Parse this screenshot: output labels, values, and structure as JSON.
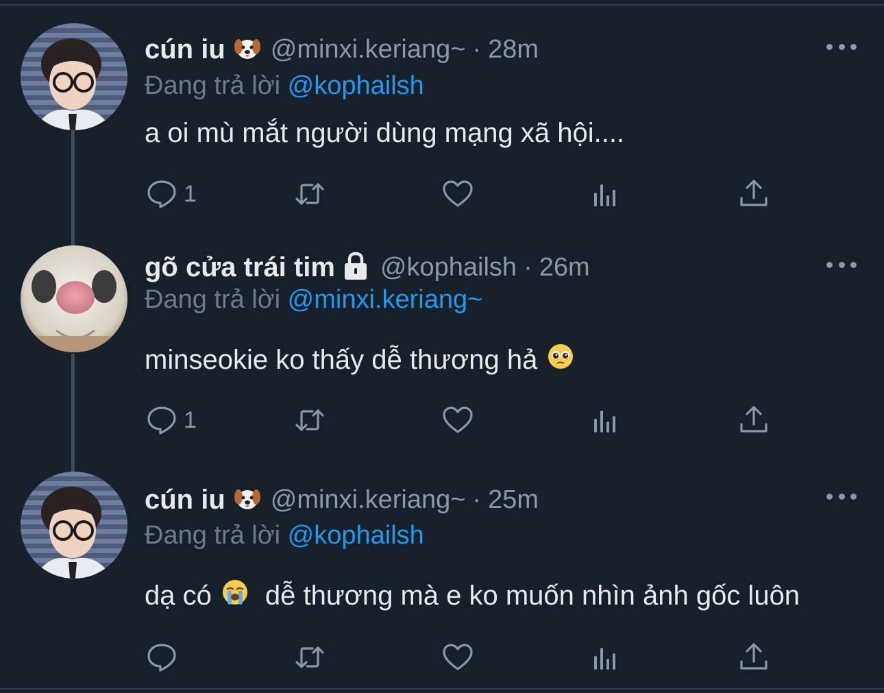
{
  "thread": {
    "tweets": [
      {
        "name": "cún iu",
        "name_emoji": "dog-face-emoji",
        "handle": "@minxi.keriang~",
        "separator": "·",
        "time": "28m",
        "replying_prefix": "Đang trả lời",
        "replying_to": "@kophailsh",
        "text": "a oi mù mắt người dùng mạng xã hội....",
        "reply_count": "1"
      },
      {
        "name": "gõ cửa trái tim",
        "name_emoji": "lock-icon",
        "handle": "@kophailsh",
        "separator": "·",
        "time": "26m",
        "replying_prefix": "Đang trả lời",
        "replying_to": "@minxi.keriang~",
        "text": "minseokie ko thấy dễ thương hả",
        "text_emoji": "pleading-face-emoji",
        "reply_count": "1"
      },
      {
        "name": "cún iu",
        "name_emoji": "dog-face-emoji",
        "handle": "@minxi.keriang~",
        "separator": "·",
        "time": "25m",
        "replying_prefix": "Đang trả lời",
        "replying_to": "@kophailsh",
        "text_before": "dạ có",
        "text_emoji": "loudly-crying-face-emoji",
        "text_after": "dễ thương mà e ko muốn nhìn ảnh gốc luôn",
        "reply_count": ""
      }
    ]
  },
  "colors": {
    "background": "#15202b",
    "primary_text": "#e7e9ea",
    "secondary_text": "#8b98a5",
    "accent": "#1d9bf0"
  }
}
